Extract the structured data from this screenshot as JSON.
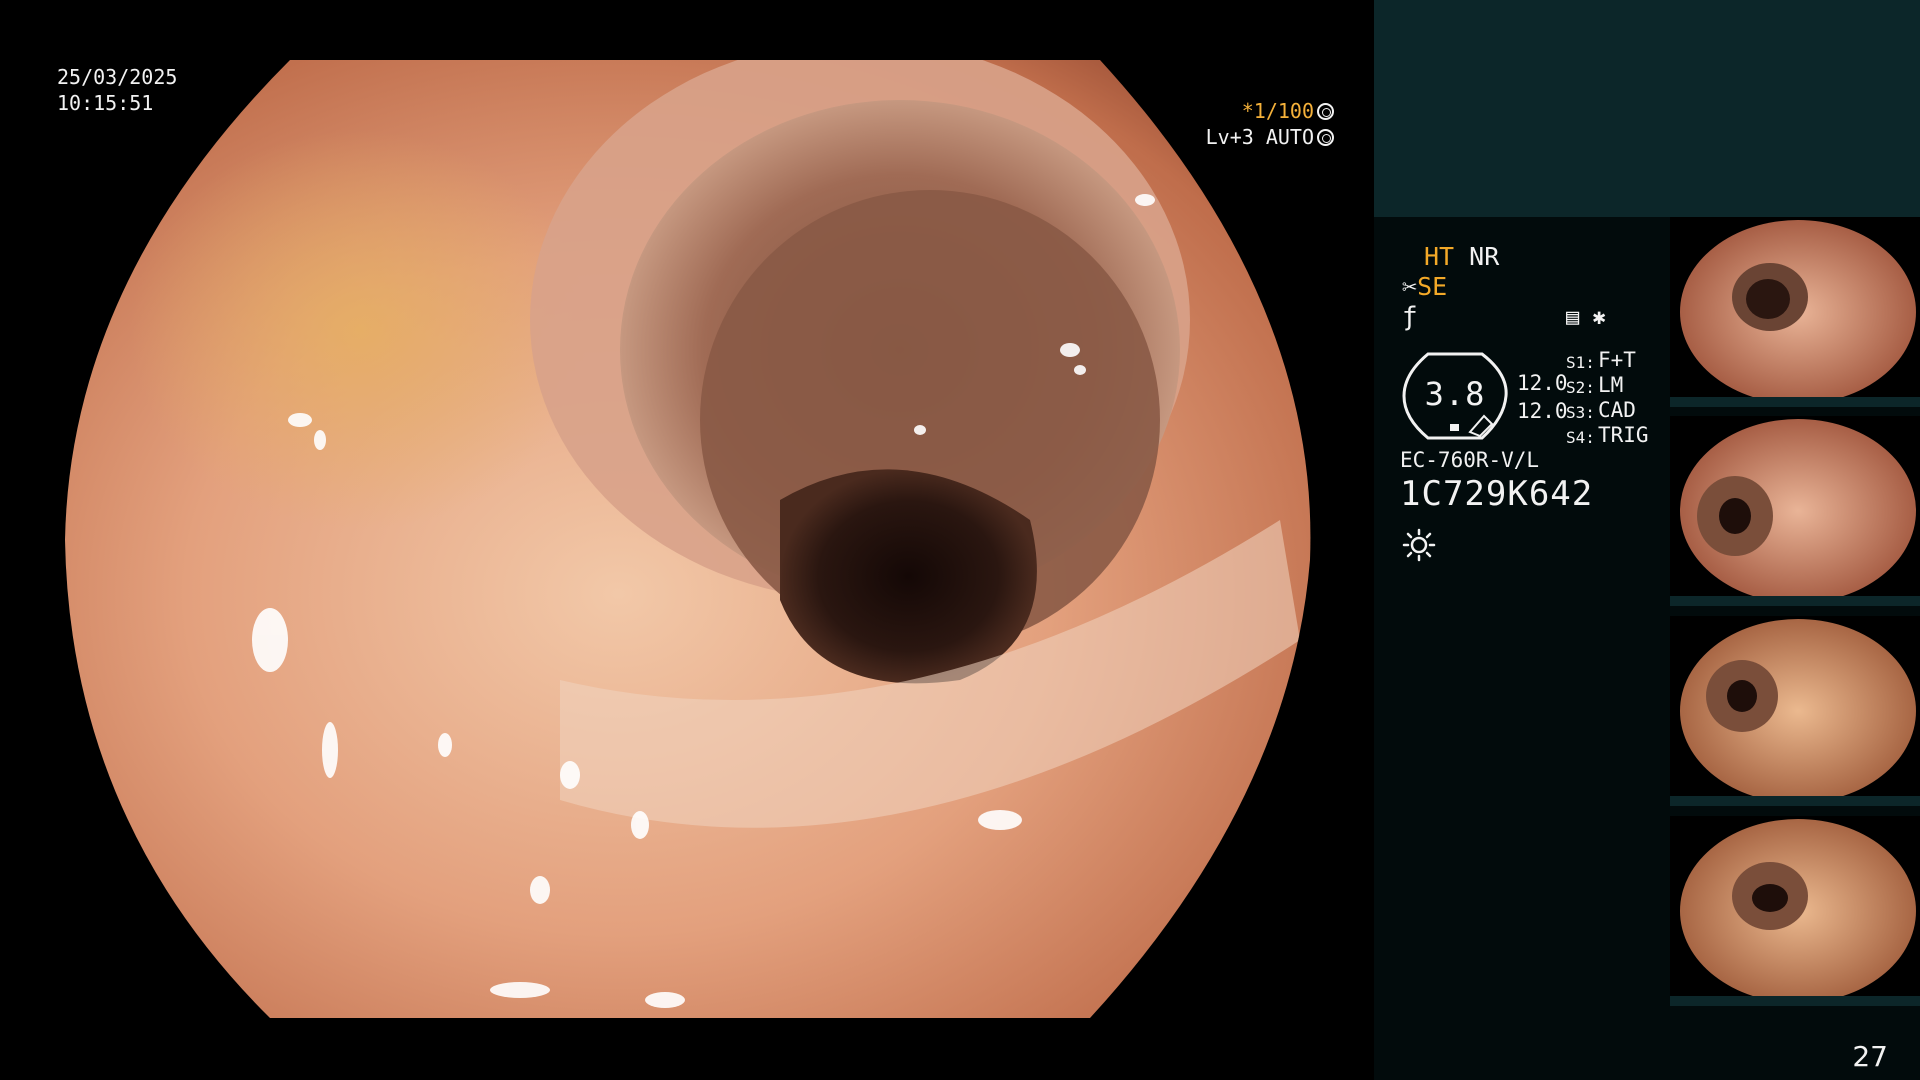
{
  "osd": {
    "date": "25/03/2025",
    "time": "10:15:51",
    "shutter": "*1/100",
    "level": "Lv+3",
    "mode": "AUTO"
  },
  "panel": {
    "ht": "HT",
    "nr": "NR",
    "se": "SE",
    "gauge_value": "3.8",
    "num1": "12.0",
    "num2": "12.0",
    "switches": [
      {
        "label": "S1:",
        "value": "F+T"
      },
      {
        "label": "S2:",
        "value": "LM"
      },
      {
        "label": "S3:",
        "value": "CAD"
      },
      {
        "label": "S4:",
        "value": "TRIG"
      }
    ],
    "scope_model": "EC-760R-V/L",
    "scope_serial": "1C729K642",
    "image_count": "27"
  },
  "colors": {
    "accent_yellow": "#f3a928",
    "panel_bg": "#020b0c",
    "panel_top": "#0c2629"
  },
  "icons": [
    "shutter-icon",
    "auto-iris-icon",
    "document-icon",
    "asterisk-icon",
    "light-source-icon",
    "freeze-icon"
  ]
}
